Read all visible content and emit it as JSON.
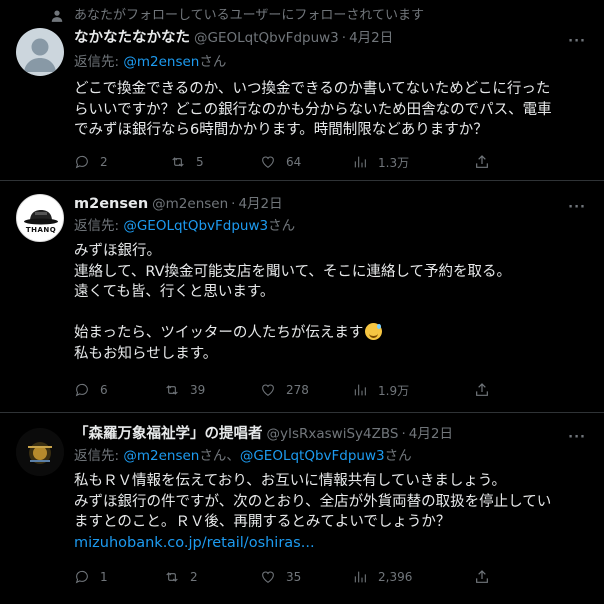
{
  "context_banner": {
    "text": "あなたがフォローしているユーザーにフォローされています"
  },
  "tweets": [
    {
      "name": "なかなたなかなた",
      "handle": "@GEOLqtQbvFdpuw3",
      "dot": "·",
      "date": "4月2日",
      "reply_prefix": "返信先: ",
      "reply_mentions": [
        "@m2ensen"
      ],
      "reply_suffix": "さん",
      "lines": [
        "どこで換金できるのか、いつ換金できるのか書いてないためどこに行った",
        "らいいですか？どこの銀行なのかも分からないため田舎なのでパス、電車",
        "でみずほ銀行なら6時間かかります。時間制限などありますか？"
      ],
      "replies": "2",
      "retweets": "5",
      "likes": "64",
      "views": "1.3万"
    },
    {
      "name": "m2ensen",
      "handle": "@m2ensen",
      "dot": "·",
      "date": "4月2日",
      "avatar_text": "THANQ",
      "reply_prefix": "返信先: ",
      "reply_mentions": [
        "@GEOLqtQbvFdpuw3"
      ],
      "reply_suffix": "さん",
      "lines": [
        "みずほ銀行。",
        "連絡して、RV換金可能支店を聞いて、そこに連絡して予約を取る。",
        "遠くても皆、行くと思います。",
        "",
        "始まったら、ツイッターの人たちが伝えます",
        "私もお知らせします。"
      ],
      "replies": "6",
      "retweets": "39",
      "likes": "278",
      "views": "1.9万"
    },
    {
      "name": "「森羅万象福祉学」の提唱者",
      "handle": "@yIsRxaswiSy4ZBS",
      "dot": "·",
      "date": "4月2日",
      "reply_prefix": "返信先: ",
      "reply_mentions": [
        "@m2ensen",
        "@GEOLqtQbvFdpuw3"
      ],
      "reply_mid": "さん、",
      "reply_suffix": "さん",
      "lines": [
        "私もＲＶ情報を伝えており、お互いに情報共有していきましょう。",
        "みずほ銀行の件ですが、次のとおり、全店が外貨両替の取扱を停止してい",
        "ますとのこと。ＲＶ後、再開するとみてよいでしょうか？"
      ],
      "link": "mizuhobank.co.jp/retail/oshiras...",
      "replies": "1",
      "retweets": "2",
      "likes": "35",
      "views": "2,396"
    }
  ],
  "more_label": "···",
  "colors": {
    "accent": "#1d9bf0",
    "muted": "#71767b",
    "text": "#e7e9ea",
    "background": "#000000"
  }
}
